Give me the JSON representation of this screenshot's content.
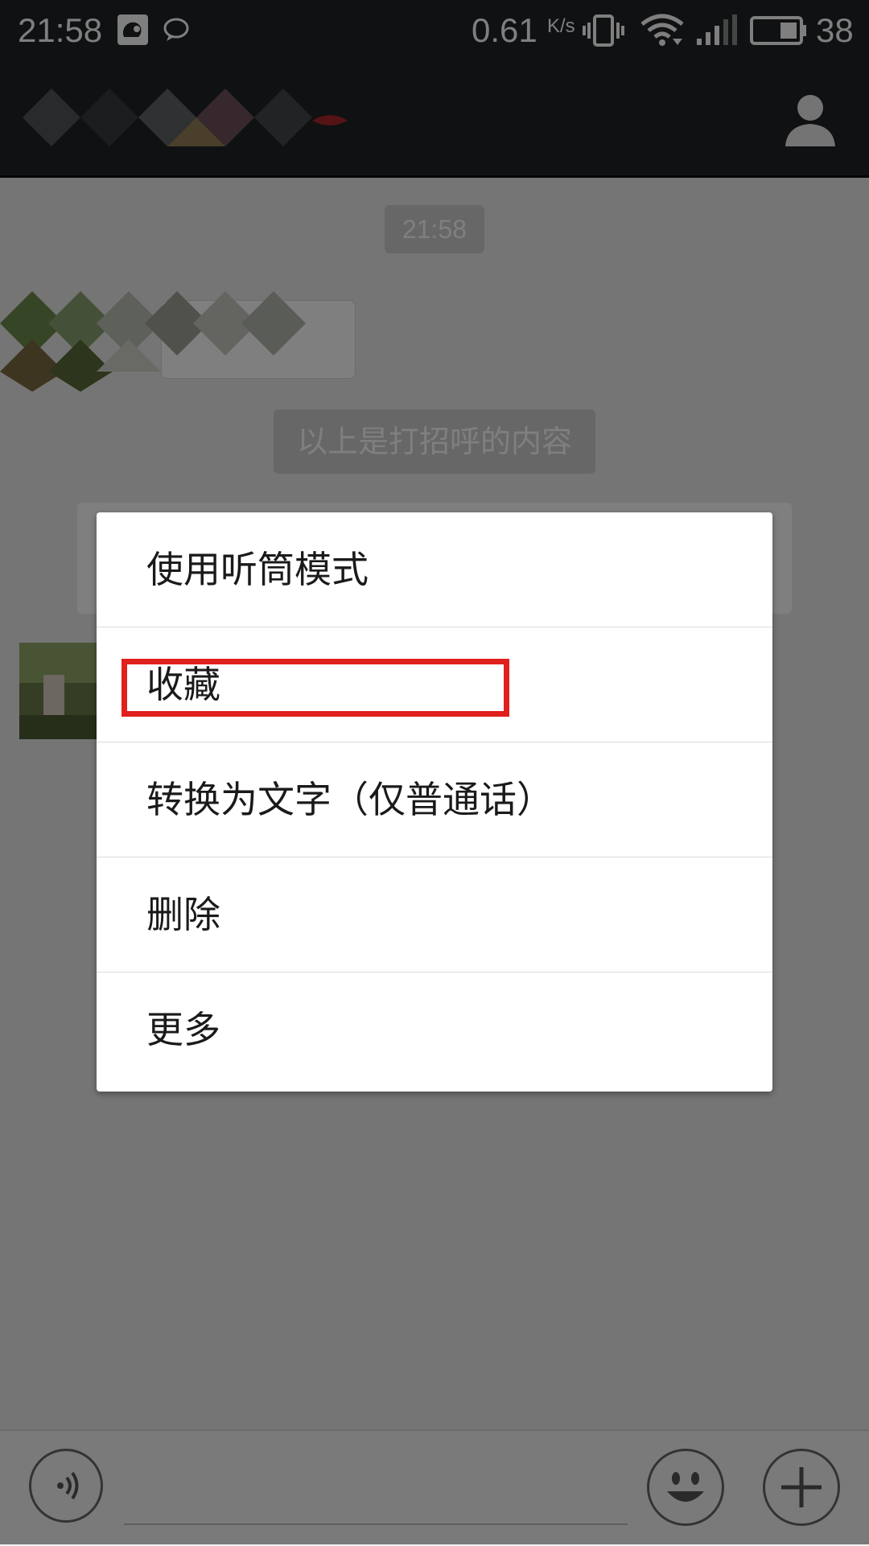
{
  "status_bar": {
    "time": "21:58",
    "net_speed": "0.61",
    "net_speed_unit": "K/s",
    "battery_level": "38",
    "icons": [
      "uc-browser-icon",
      "chat-bubble-icon",
      "vibrate-icon",
      "wifi-icon",
      "signal-icon",
      "battery-icon"
    ]
  },
  "title_bar": {
    "icons": [
      "profile-icon"
    ]
  },
  "chat": {
    "time_chip": "21:58",
    "system_notice": "以上是打招呼的内容"
  },
  "context_menu": {
    "items": [
      {
        "label": "使用听筒模式"
      },
      {
        "label": "收藏",
        "highlighted": true
      },
      {
        "label": "转换为文字（仅普通话）"
      },
      {
        "label": "删除"
      },
      {
        "label": "更多"
      }
    ],
    "highlight_color": "#e0201c"
  },
  "input_bar": {
    "icons": [
      "voice-toggle-icon",
      "emoji-icon",
      "plus-icon"
    ]
  }
}
